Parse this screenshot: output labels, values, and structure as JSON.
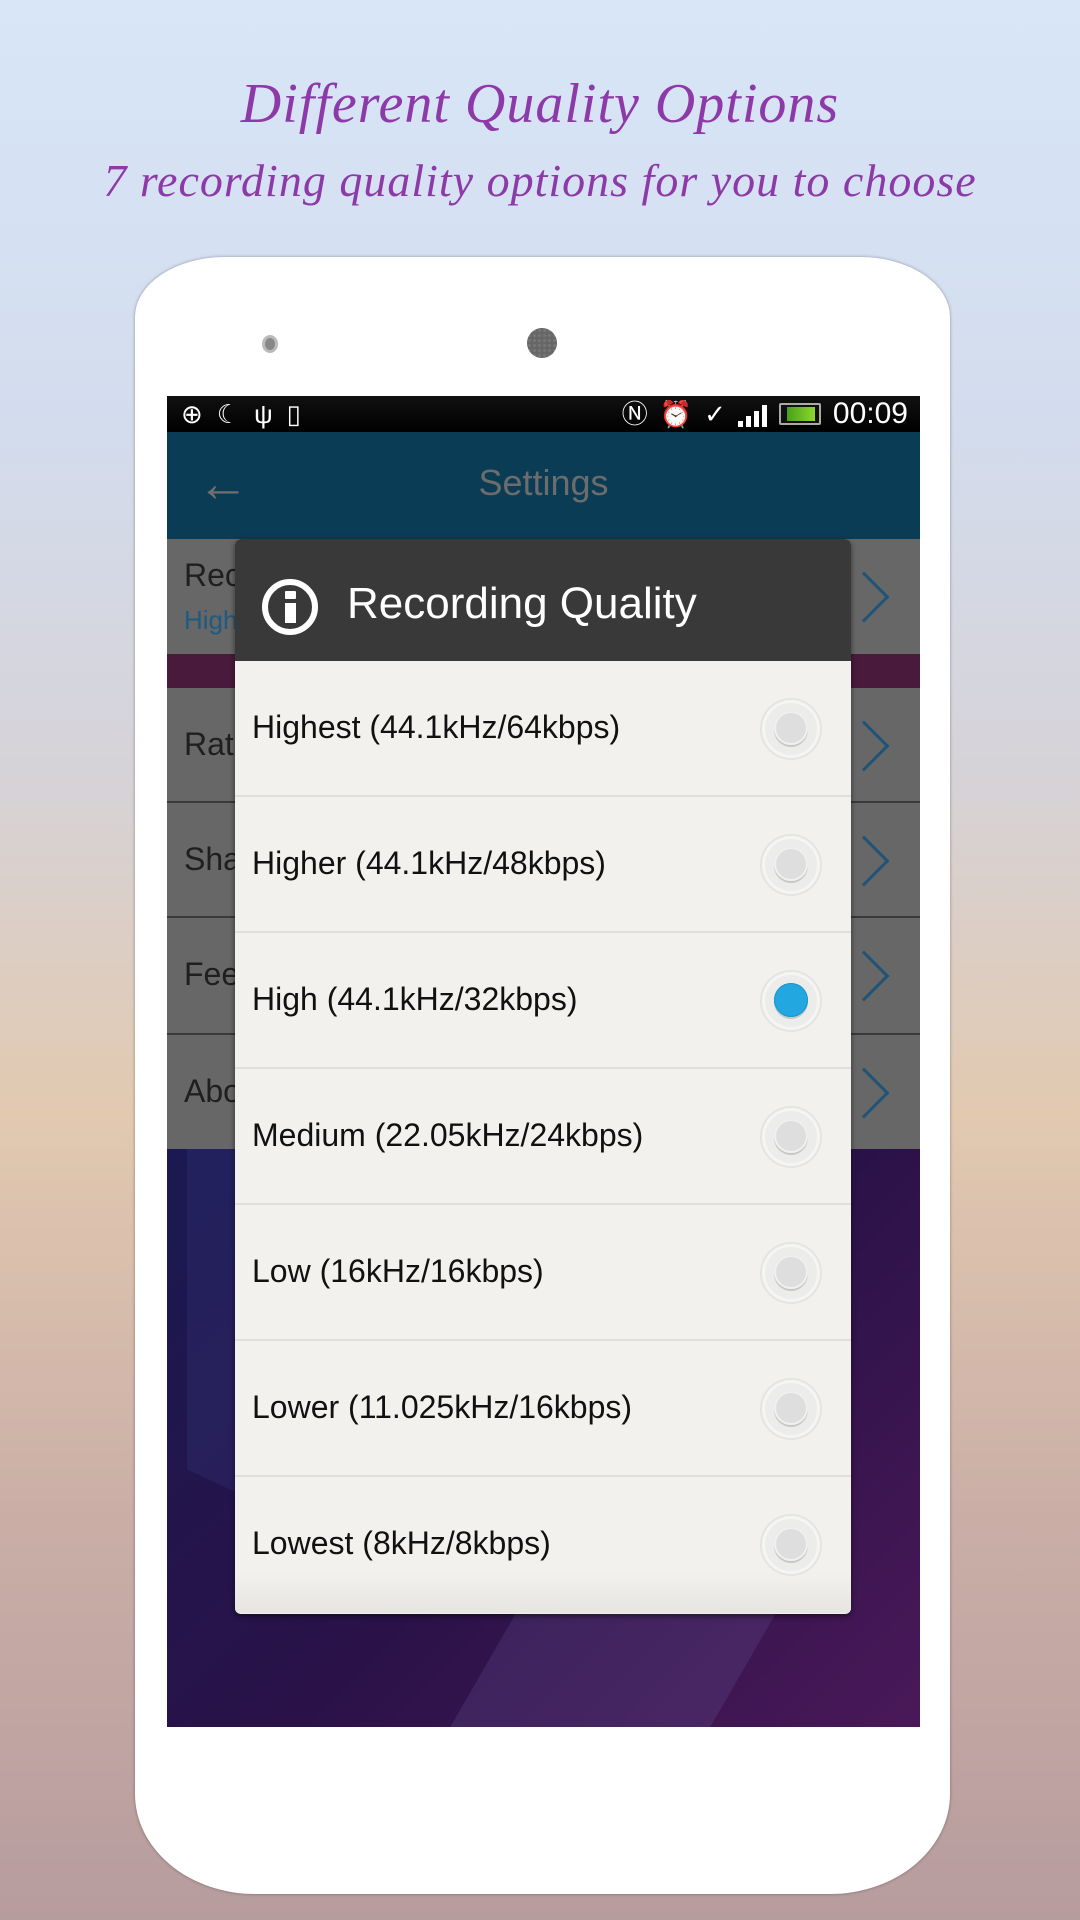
{
  "promo": {
    "title": "Different Quality Options",
    "subtitle": "7 recording quality options for you to choose"
  },
  "status_bar": {
    "left_icons": [
      "download-sync-icon",
      "moon-icon",
      "usb-icon",
      "android-debug-icon"
    ],
    "right_icons": [
      "nfc-icon",
      "alarm-icon",
      "sync-check-icon",
      "signal-icon",
      "battery-charging-icon"
    ],
    "time": "00:09"
  },
  "app_bar": {
    "title": "Settings",
    "back_icon": "arrow-left-icon"
  },
  "settings": {
    "items": [
      {
        "label": "Recording Quality",
        "visible_label": "Rec",
        "sublabel": "High",
        "visible_sublabel": "High"
      },
      {
        "label": "Rate",
        "visible_label": "Rat"
      },
      {
        "label": "Share",
        "visible_label": "Sha"
      },
      {
        "label": "Feedback",
        "visible_label": "Fee"
      },
      {
        "label": "About",
        "visible_label": "Abo"
      }
    ]
  },
  "dialog": {
    "title": "Recording Quality",
    "icon": "info-icon",
    "selected_index": 2,
    "options": [
      {
        "label": "Highest (44.1kHz/64kbps)",
        "checked": false
      },
      {
        "label": "Higher (44.1kHz/48kbps)",
        "checked": false
      },
      {
        "label": "High (44.1kHz/32kbps)",
        "checked": true
      },
      {
        "label": "Medium (22.05kHz/24kbps)",
        "checked": false
      },
      {
        "label": "Low (16kHz/16kbps)",
        "checked": false
      },
      {
        "label": "Lower (11.025kHz/16kbps)",
        "checked": false
      },
      {
        "label": "Lowest (8kHz/8kbps)",
        "checked": false
      }
    ]
  },
  "colors": {
    "promo_text": "#8d3aa8",
    "radio_selected": "#22a7e0",
    "app_bar": "#0b3c55",
    "dialog_header": "#393939"
  }
}
